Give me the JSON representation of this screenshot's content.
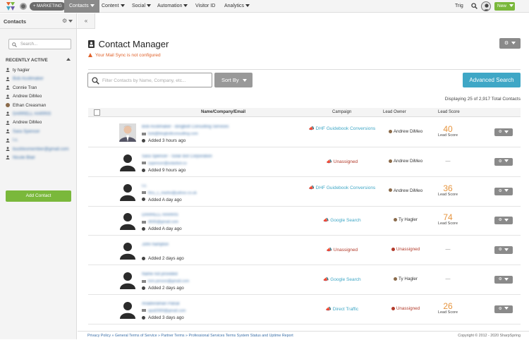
{
  "topbar": {
    "marketing_label": "MARKETING",
    "nav": [
      {
        "label": "Contacts",
        "active": true,
        "caret": true
      },
      {
        "label": "Content",
        "active": false,
        "caret": true
      },
      {
        "label": "Social",
        "active": false,
        "caret": true
      },
      {
        "label": "Automation",
        "active": false,
        "caret": true
      },
      {
        "label": "Visitor ID",
        "active": false,
        "caret": false
      },
      {
        "label": "Analytics",
        "active": false,
        "caret": true
      }
    ],
    "user": "Trig",
    "new_label": "New"
  },
  "sidebar": {
    "title": "Contacts",
    "search_placeholder": "Search...",
    "recent_title": "RECENTLY ACTIVE",
    "items": [
      {
        "label": "ty hagler",
        "blurred": false,
        "icon": "person-icon"
      },
      {
        "label": "Bob Acolimaker",
        "blurred": true,
        "icon": "person-icon"
      },
      {
        "label": "Connie Tran",
        "blurred": false,
        "icon": "person-icon"
      },
      {
        "label": "Andrew DiMeo",
        "blurred": false,
        "icon": "person-icon"
      },
      {
        "label": "Ethan Creasman",
        "blurred": false,
        "icon": "avatar-icon"
      },
      {
        "label": "DARRELL HARRIS",
        "blurred": true,
        "icon": "person-icon"
      },
      {
        "label": "Andrew DiMeo",
        "blurred": false,
        "icon": "person-icon"
      },
      {
        "label": "Sara Spencer",
        "blurred": true,
        "icon": "person-icon"
      },
      {
        "label": "l.c.",
        "blurred": true,
        "icon": "person-icon"
      },
      {
        "label": "bucklesmember@gmail.com",
        "blurred": true,
        "icon": "person-icon"
      },
      {
        "label": "Nicole Blair",
        "blurred": true,
        "icon": "person-icon"
      }
    ],
    "add_contact_label": "Add Contact"
  },
  "main": {
    "title": "Contact Manager",
    "warning": "Your Mail Sync is not configured",
    "filter_placeholder": "Filter Contacts by Name, Company, etc...",
    "sort_label": "Sort By",
    "advanced_search_label": "Advanced Search",
    "display_text": "Displaying 25 of 2,917 Total Contacts",
    "columns": {
      "name": "Name/Company/Email",
      "campaign": "Campaign",
      "owner": "Lead Owner",
      "score": "Lead Score"
    },
    "rows": [
      {
        "name": "Bob Acolimaker - Bingbolt Consulting Services",
        "email": "bob@bingboltconsulting.com",
        "added": "Added 3 hours ago",
        "campaign": "DHF Guidebook Conversions",
        "owner": "Andrew DiMeo",
        "score": "40",
        "score_label": "Lead Score",
        "photo": true
      },
      {
        "name": "Sara Spencer - Solar Bot Corporation",
        "email": "sspencer@solarbot.co",
        "added": "Added 9 hours ago",
        "campaign": "Unassigned",
        "owner": "Andrew DiMeo",
        "score": "",
        "score_label": "",
        "photo": false
      },
      {
        "name": "l.c.",
        "email": "thru_c_marko@yahoo.co.uk",
        "added": "Added A day ago",
        "campaign": "DHF Guidebook Conversions",
        "owner": "Andrew DiMeo",
        "score": "36",
        "score_label": "Lead Score",
        "photo": false
      },
      {
        "name": "DARRELL HARRIS",
        "email": "dh55@gmail.com",
        "added": "Added A day ago",
        "campaign": "Google Search",
        "owner": "Ty Hagler",
        "score": "74",
        "score_label": "Lead Score",
        "photo": false
      },
      {
        "name": "John hampton",
        "email": "",
        "added": "Added 2 days ago",
        "campaign": "Unassigned",
        "owner": "Unassigned",
        "score": "",
        "score_label": "",
        "photo": false
      },
      {
        "name": "Name not provided",
        "email": "tom.person@gmail.com",
        "added": "Added 2 days ago",
        "campaign": "Google Search",
        "owner": "Ty Hagler",
        "score": "",
        "score_label": "",
        "photo": false
      },
      {
        "name": "Anadivraman Palsal",
        "email": "apal2000@gmail.com",
        "added": "Added 3 days ago",
        "campaign": "Direct Traffic",
        "owner": "Unassigned",
        "score": "26",
        "score_label": "Lead Score",
        "photo": false
      }
    ],
    "empty_score": "—"
  },
  "footer": {
    "links": "Privacy Policy » General Terms of Service » Partner Terms » Professional Services Terms System Status and Uptime Report",
    "copyright": "Copyright © 2012 - 2020 SharpSpring"
  },
  "colors": {
    "accent_green": "#7ab83b",
    "accent_blue": "#3fa7c6",
    "score_orange": "#e6953f",
    "warning_orange": "#e0622b",
    "link_blue": "#3a6fa8"
  }
}
